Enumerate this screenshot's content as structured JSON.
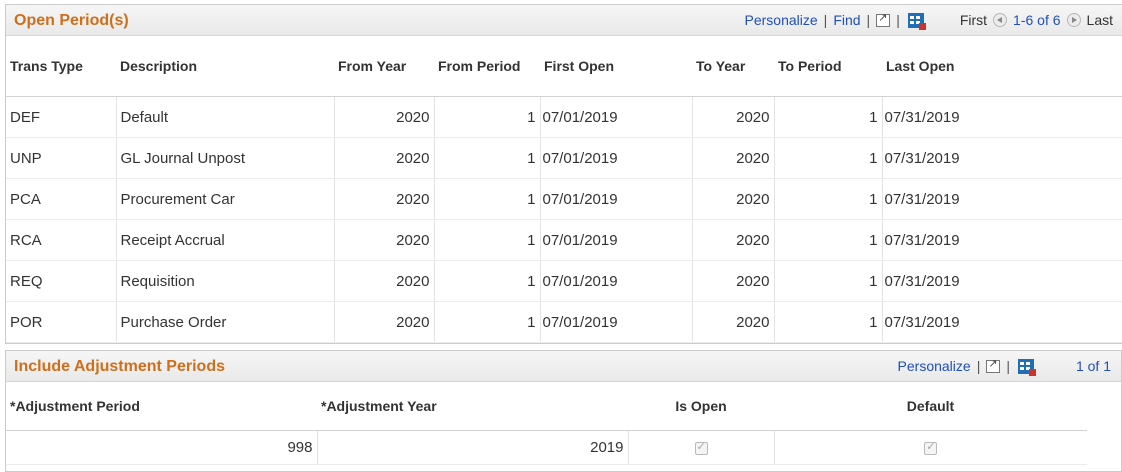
{
  "open_periods": {
    "title": "Open Period(s)",
    "nav": {
      "personalize": "Personalize",
      "find": "Find",
      "first": "First",
      "range": "1-6 of 6",
      "last": "Last"
    },
    "columns": [
      "Trans Type",
      "Description",
      "From Year",
      "From Period",
      "First Open",
      "To Year",
      "To Period",
      "Last Open"
    ],
    "rows": [
      [
        "DEF",
        "Default",
        "2020",
        "1",
        "07/01/2019",
        "2020",
        "1",
        "07/31/2019"
      ],
      [
        "UNP",
        "GL Journal Unpost",
        "2020",
        "1",
        "07/01/2019",
        "2020",
        "1",
        "07/31/2019"
      ],
      [
        "PCA",
        "Procurement Car",
        "2020",
        "1",
        "07/01/2019",
        "2020",
        "1",
        "07/31/2019"
      ],
      [
        "RCA",
        "Receipt Accrual",
        "2020",
        "1",
        "07/01/2019",
        "2020",
        "1",
        "07/31/2019"
      ],
      [
        "REQ",
        "Requisition",
        "2020",
        "1",
        "07/01/2019",
        "2020",
        "1",
        "07/31/2019"
      ],
      [
        "POR",
        "Purchase Order",
        "2020",
        "1",
        "07/01/2019",
        "2020",
        "1",
        "07/31/2019"
      ]
    ]
  },
  "adjustment_periods": {
    "title": "Include Adjustment Periods",
    "nav": {
      "personalize": "Personalize",
      "range": "1 of 1"
    },
    "columns": [
      "*Adjustment Period",
      "*Adjustment Year",
      "Is Open",
      "Default"
    ],
    "rows": [
      {
        "period": "998",
        "year": "2019",
        "is_open": true,
        "default": true
      }
    ]
  }
}
